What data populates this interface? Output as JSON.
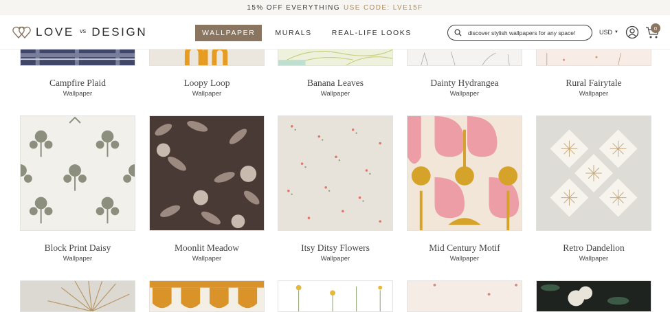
{
  "promo": {
    "text": "15% OFF EVERYTHING",
    "code_text": "USE CODE: LVE15F"
  },
  "header": {
    "logo": {
      "word1": "LOVE",
      "vs": "vs",
      "word2": "DESIGN"
    },
    "nav": [
      {
        "label": "WALLPAPER",
        "active": true
      },
      {
        "label": "MURALS",
        "active": false
      },
      {
        "label": "REAL-LIFE LOOKS",
        "active": false
      }
    ],
    "search": {
      "placeholder": "discover stylish wallpapers for any space!"
    },
    "currency": "USD",
    "cart_count": "0"
  },
  "products": {
    "row1": [
      {
        "name": "Campfire Plaid",
        "type": "Wallpaper"
      },
      {
        "name": "Loopy Loop",
        "type": "Wallpaper"
      },
      {
        "name": "Banana Leaves",
        "type": "Wallpaper"
      },
      {
        "name": "Dainty Hydrangea",
        "type": "Wallpaper"
      },
      {
        "name": "Rural Fairytale",
        "type": "Wallpaper"
      }
    ],
    "row2": [
      {
        "name": "Block Print Daisy",
        "type": "Wallpaper"
      },
      {
        "name": "Moonlit Meadow",
        "type": "Wallpaper"
      },
      {
        "name": "Itsy Ditsy Flowers",
        "type": "Wallpaper"
      },
      {
        "name": "Mid Century Motif",
        "type": "Wallpaper"
      },
      {
        "name": "Retro Dandelion",
        "type": "Wallpaper"
      }
    ]
  },
  "colors": {
    "accent": "#8a7560",
    "code": "#b08a54",
    "promo_bg": "#f7f5f1"
  },
  "icons": [
    "search-icon",
    "account-icon",
    "cart-icon",
    "chevron-down-icon",
    "heart-logo-icon"
  ]
}
